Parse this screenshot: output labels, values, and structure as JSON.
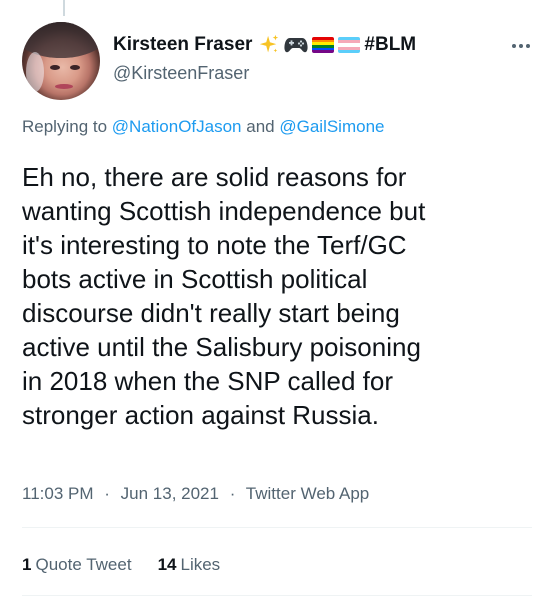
{
  "tweet": {
    "author": {
      "display_name": "Kirsteen Fraser",
      "handle": "@KirsteenFraser",
      "name_hashtag": "#BLM",
      "name_emojis": [
        "sparkles-icon",
        "video-game-icon",
        "rainbow-flag-icon",
        "transgender-flag-icon"
      ]
    },
    "replying_to": {
      "prefix": "Replying to",
      "users": [
        "@NationOfJason",
        "@GailSimone"
      ],
      "conjunction": "and"
    },
    "text_lines": [
      "Eh no, there are solid reasons for",
      "wanting Scottish independence but",
      "it's interesting to note the Terf/GC",
      "bots active in Scottish political",
      "discourse didn't really start being",
      "active until the Salisbury poisoning",
      "in 2018 when the SNP called for",
      "stronger action against Russia."
    ],
    "time": "11:03 PM",
    "date": "Jun 13, 2021",
    "source": "Twitter Web App",
    "separator": "·",
    "stats": {
      "quote_tweets_count": "1",
      "quote_tweets_label": "Quote Tweet",
      "likes_count": "14",
      "likes_label": "Likes"
    }
  },
  "colors": {
    "text": "#0f1419",
    "secondary": "#536471",
    "link": "#1d9bf0",
    "divider": "#eff3f4"
  }
}
